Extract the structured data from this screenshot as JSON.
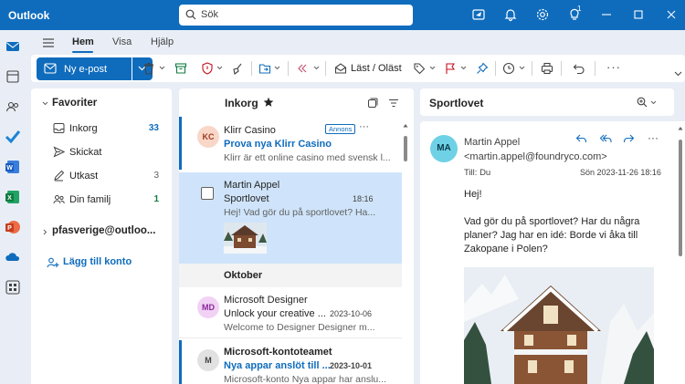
{
  "titlebar": {
    "app_title": "Outlook",
    "search_placeholder": "Sök",
    "notification_badge": "1"
  },
  "ribbon": {
    "tabs": [
      "Hem",
      "Visa",
      "Hjälp"
    ],
    "active_tab": "Hem",
    "new_mail_label": "Ny e-post",
    "read_unread_label": "Läst / Oläst"
  },
  "folders": {
    "favorites_label": "Favoriter",
    "items": [
      {
        "name": "Inkorg",
        "count": "33",
        "icon": "inbox-icon"
      },
      {
        "name": "Skickat",
        "count": "",
        "icon": "send-icon"
      },
      {
        "name": "Utkast",
        "count": "3",
        "icon": "draft-icon"
      },
      {
        "name": "Din familj",
        "count": "1",
        "icon": "people-icon"
      }
    ],
    "account_label": "pfasverige@outloo...",
    "add_account_label": "Lägg till konto"
  },
  "message_list": {
    "title": "Inkorg",
    "section_label": "Oktober",
    "messages": [
      {
        "sender": "Klirr Casino",
        "subject": "Prova nya Klirr Casino",
        "preview": "Klirr är ett online casino med svensk l...",
        "date": "",
        "badge": "Annons",
        "initials": "KC",
        "unread": true
      },
      {
        "sender": "Martin Appel",
        "subject": "Sportlovet",
        "preview": "Hej! Vad gör du på sportlovet? Ha...",
        "date": "18:16",
        "badge": "",
        "initials": "",
        "unread": false
      },
      {
        "sender": "Microsoft Designer",
        "subject": "Unlock your creative ...",
        "preview": "Welcome to Designer Designer m...",
        "date": "2023-10-06",
        "badge": "",
        "initials": "MD",
        "unread": false
      },
      {
        "sender": "Microsoft-kontoteamet",
        "subject": "Nya appar anslöt till ...",
        "preview": "Microsoft-konto Nya appar har anslu...",
        "date": "2023-10-01",
        "badge": "",
        "initials": "M",
        "unread": true
      }
    ]
  },
  "reading_pane": {
    "subject": "Sportlovet",
    "initials": "MA",
    "from_name": "Martin Appel",
    "from_email": "<martin.appel@foundryco.com>",
    "to_label": "Till:",
    "to_value": "Du",
    "date": "Sön 2023-11-26 18:16",
    "body_greeting": "Hej!",
    "body_lines": [
      "Vad gör du på sportlovet? Har du några",
      "planer? Jag har en idé: Borde vi åka till",
      "Zakopane i Polen?"
    ]
  },
  "colors": {
    "brand_blue": "#0f6cbd",
    "selected_row": "#cfe4fa",
    "app_background": "#e9eef6"
  }
}
